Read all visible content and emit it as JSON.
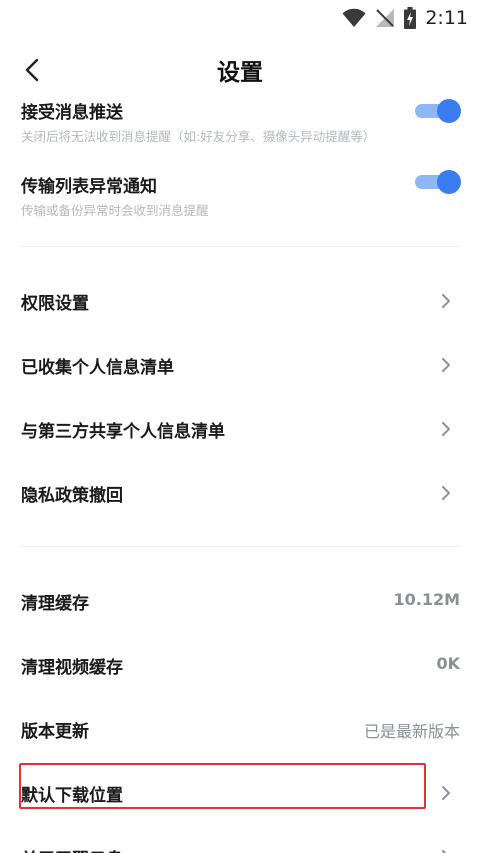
{
  "status_bar": {
    "time": "2:11"
  },
  "header": {
    "title": "设置"
  },
  "toggles": [
    {
      "title": "接受消息推送",
      "description": "关闭后将无法收到消息提醒（如:好友分享、摄像头异动提醒等）",
      "on": true
    },
    {
      "title": "传输列表异常通知",
      "description": "传输或备份异常时会收到消息提醒",
      "on": true
    }
  ],
  "privacy_items": [
    {
      "label": "权限设置"
    },
    {
      "label": "已收集个人信息清单"
    },
    {
      "label": "与第三方共享个人信息清单"
    },
    {
      "label": "隐私政策撤回"
    }
  ],
  "storage_items": [
    {
      "label": "清理缓存",
      "value": "10.12M"
    },
    {
      "label": "清理视频缓存",
      "value": "0K"
    },
    {
      "label": "版本更新",
      "value": "已是最新版本"
    },
    {
      "label": "默认下载位置"
    },
    {
      "label": "关于天翼云盘"
    }
  ],
  "colors": {
    "accent": "#3b7cf0",
    "highlight": "#e5312f"
  }
}
